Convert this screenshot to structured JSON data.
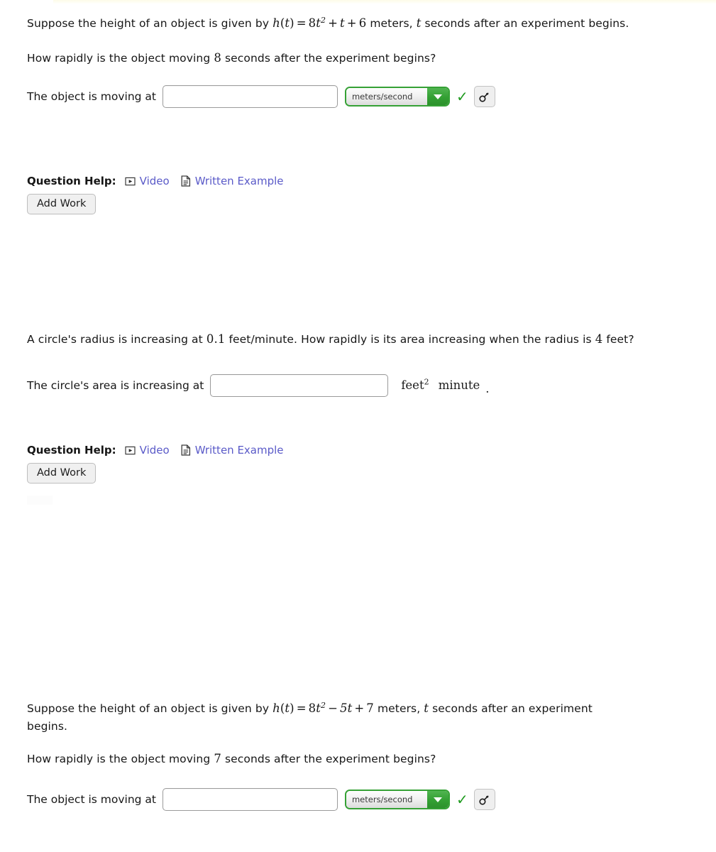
{
  "page": {
    "background": "#ffffff",
    "top_strip_color": "#fdfbe8",
    "link_color": "#5a5ac8",
    "accent_green": "#35a135",
    "check_color": "#1f9b1f"
  },
  "problems": [
    {
      "id": "problem-1",
      "statement": {
        "lead": "Suppose the height of an object is given by",
        "function_name": "h",
        "arg_open": "(",
        "variable": "t",
        "arg_close": ")",
        "equals": "=",
        "coefficient": "8",
        "base": "t",
        "exponent": "2",
        "plus_1": "+",
        "term_2": "t",
        "plus_2": "+",
        "constant": "6",
        "unit_word": "meters,",
        "var_tail": "t",
        "tail": "seconds after an experiment begins."
      },
      "question": {
        "before": "How rapidly is the object moving",
        "value": "8",
        "after": "seconds after the experiment begins?"
      },
      "answer": {
        "label": "The object is moving at",
        "input_value": "",
        "input_placeholder": "",
        "unit_selected": "meters/second"
      },
      "help": {
        "label": "Question Help:",
        "video_label": "Video",
        "written_label": "Written Example",
        "add_work_label": "Add Work"
      }
    },
    {
      "id": "problem-2",
      "statement": {
        "before": "A circle's radius is increasing at",
        "rate": "0.1",
        "middle": "feet/minute. How rapidly is its area increasing when the radius is",
        "radius": "4",
        "after": "feet?"
      },
      "answer": {
        "label": "The circle's area is increasing at",
        "input_value": "",
        "input_placeholder": "",
        "unit_numerator": "feet",
        "unit_numerator_exponent": "2",
        "unit_denominator": "minute",
        "trailing_punctuation": "."
      },
      "help": {
        "label": "Question Help:",
        "video_label": "Video",
        "written_label": "Written Example",
        "add_work_label": "Add Work"
      }
    },
    {
      "id": "problem-3",
      "statement": {
        "lead": "Suppose the height of an object is given by",
        "function_name": "h",
        "arg_open": "(",
        "variable": "t",
        "arg_close": ")",
        "equals": "=",
        "coefficient": "8",
        "base": "t",
        "exponent": "2",
        "minus": "−",
        "term_2": "5t",
        "plus": "+",
        "constant": "7",
        "unit_word": "meters,",
        "var_tail": "t",
        "tail": "seconds after an experiment",
        "tail_line2": "begins."
      },
      "question": {
        "before": "How rapidly is the object moving",
        "value": "7",
        "after": "seconds after the experiment begins?"
      },
      "answer": {
        "label": "The object is moving at",
        "input_value": "",
        "input_placeholder": "",
        "unit_selected": "meters/second"
      }
    }
  ],
  "icons": {
    "video": "video-play-icon",
    "written": "document-icon",
    "dropdown": "chevron-down-icon",
    "verified": "check-icon",
    "keyboard": "key-icon"
  }
}
